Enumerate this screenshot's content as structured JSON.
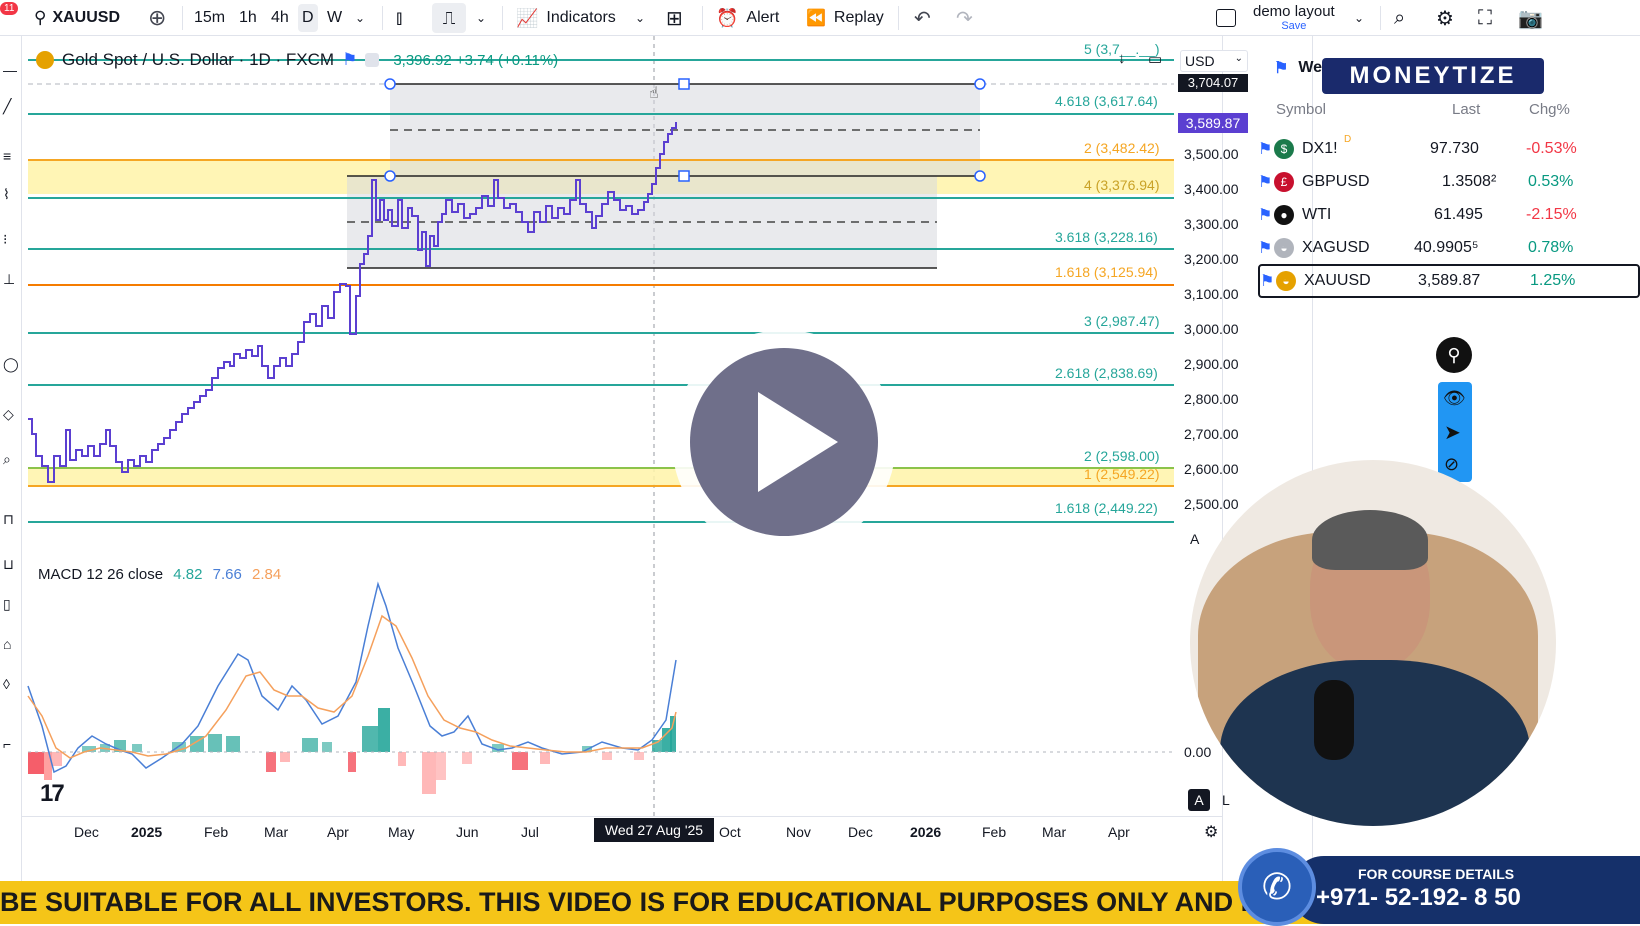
{
  "toolbar": {
    "symbol": "XAUUSD",
    "intervals": [
      "15m",
      "1h",
      "4h",
      "D",
      "W"
    ],
    "indicators_label": "Indicators",
    "alert_label": "Alert",
    "replay_label": "Replay",
    "layout_name": "demo layout",
    "layout_save": "Save",
    "notif_badge": "11"
  },
  "chart": {
    "title": "Gold Spot / U.S. Dollar · 1D · FXCM",
    "price_info": "3,396.92 +3.74 (+0.11%)",
    "currency": "USD",
    "cursor_date": "Wed 27 Aug '25",
    "macd_label": "MACD 12 26 close",
    "macd_values": [
      "4.82",
      "7.66",
      "2.84"
    ],
    "price_axis": [
      "3,500.00",
      "3,400.00",
      "3,300.00",
      "3,200.00",
      "3,100.00",
      "3,000.00",
      "2,900.00",
      "2,800.00",
      "2,700.00",
      "2,600.00",
      "2,500.00",
      "0.00"
    ],
    "price_tag_top": "3,704.07",
    "price_tag_current": "3,589.87",
    "time_axis": [
      "Dec",
      "2025",
      "Feb",
      "Mar",
      "Apr",
      "May",
      "Jun",
      "Jul",
      "Oct",
      "Nov",
      "Dec",
      "2026",
      "Feb",
      "Mar",
      "Apr"
    ],
    "fib_levels": [
      {
        "label": "5 (3,7__.__)",
        "color": "#26a69a"
      },
      {
        "label": "4.618 (3,617.64)",
        "color": "#26a69a"
      },
      {
        "label": "2 (3,482.42)",
        "color": "#f5a623"
      },
      {
        "label": "4 (3,376.94)",
        "color": "#c9a227"
      },
      {
        "label": "3.618 (3,228.16)",
        "color": "#26a69a"
      },
      {
        "label": "1.618 (3,125.94)",
        "color": "#f5a623"
      },
      {
        "label": "3 (2,987.47)",
        "color": "#26a69a"
      },
      {
        "label": "2.618 (2,838.69)",
        "color": "#26a69a"
      },
      {
        "label": "2 (2,598.00)",
        "color": "#26a69a"
      },
      {
        "label": "1 (2,549.22)",
        "color": "#f5a623"
      },
      {
        "label": "1.618 (2,449.22)",
        "color": "#26a69a"
      }
    ],
    "scale_buttons": [
      "A",
      "L"
    ]
  },
  "watchlist": {
    "header": "Wee",
    "col_symbol": "Symbol",
    "col_last": "Last",
    "col_chg": "Chg%",
    "rows": [
      {
        "symbol": "DX1!",
        "flag": "D",
        "last": "97.730",
        "chg": "-0.53%",
        "chg_color": "#f23645",
        "icon_color": "#1b7a4b",
        "icon_char": "$"
      },
      {
        "symbol": "GBPUSD",
        "last": "1.3508²",
        "chg": "0.53%",
        "chg_color": "#089981",
        "icon_color": "#c8102e",
        "icon_char": "£"
      },
      {
        "symbol": "WTI",
        "last": "61.495",
        "chg": "-2.15%",
        "chg_color": "#f23645",
        "icon_color": "#111111",
        "icon_char": "●"
      },
      {
        "symbol": "XAGUSD",
        "last": "40.9905⁵",
        "chg": "0.78%",
        "chg_color": "#089981",
        "icon_color": "#b0b4bc",
        "icon_char": "◒"
      },
      {
        "symbol": "XAUUSD",
        "last": "3,589.87",
        "chg": "1.25%",
        "chg_color": "#089981",
        "icon_color": "#e5a100",
        "icon_char": "◒"
      }
    ]
  },
  "overlay": {
    "brand": "MONEYTIZE",
    "ticker": "BE SUITABLE FOR ALL INVESTORS. THIS VIDEO IS FOR EDUCATIONAL PURPOSES ONLY AND DOES NOT C",
    "course_label": "FOR COURSE DETAILS",
    "phone": "+971- 52-192- 8 50",
    "tv_logo": "17"
  }
}
